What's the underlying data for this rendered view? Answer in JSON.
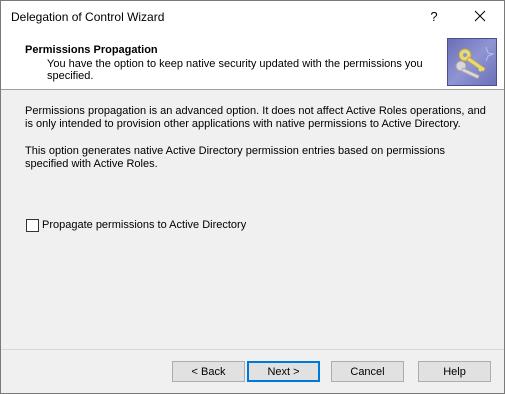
{
  "window": {
    "title": "Delegation of Control Wizard",
    "help_glyph": "?",
    "close_glyph": "✕"
  },
  "header": {
    "title": "Permissions Propagation",
    "description": "You have the option to keep native security updated with the permissions you specified.",
    "icon": "keys-icon"
  },
  "content": {
    "paragraph1": "Permissions propagation is an advanced option. It does not affect Active Roles operations, and is only intended to provision other applications with native permissions to Active Directory.",
    "paragraph2": "This option generates native Active Directory permission entries based on permissions specified with Active Roles.",
    "checkbox_label": "Propagate permissions to Active Directory",
    "checkbox_checked": false
  },
  "buttons": {
    "back": "< Back",
    "next": "Next >",
    "cancel": "Cancel",
    "help": "Help"
  },
  "colors": {
    "accent": "#0078d7"
  }
}
